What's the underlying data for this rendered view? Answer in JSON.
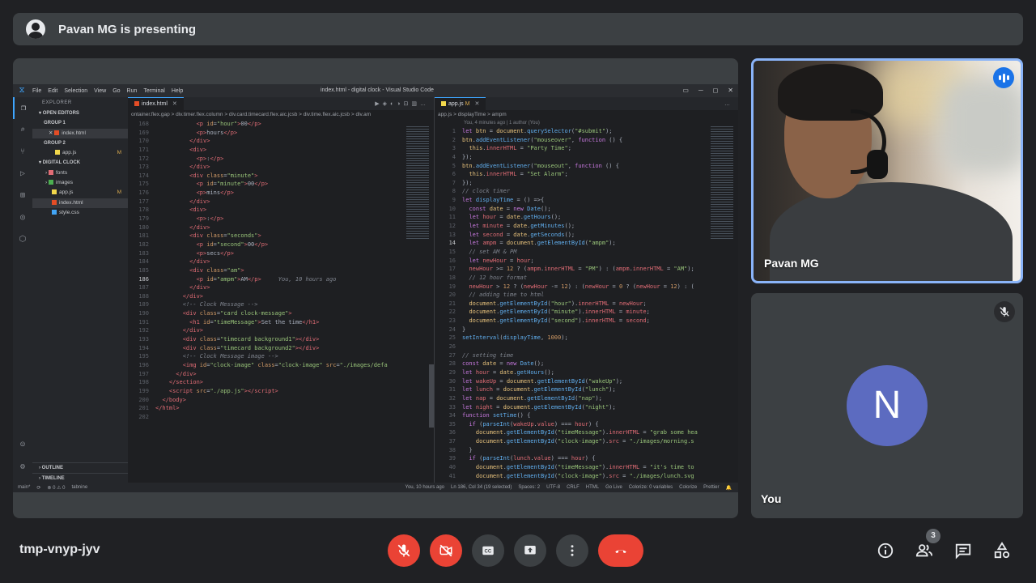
{
  "banner": {
    "text": "Pavan MG is presenting"
  },
  "vscode": {
    "window_title": "index.html - digital clock - Visual Studio Code",
    "menu": [
      "File",
      "Edit",
      "Selection",
      "View",
      "Go",
      "Run",
      "Terminal",
      "Help"
    ],
    "explorer": {
      "header": "EXPLORER",
      "open_editors": "OPEN EDITORS",
      "group1": "GROUP 1",
      "group1_file": "index.html",
      "group2": "GROUP 2",
      "group2_file": "app.js",
      "group2_mark": "M",
      "project": "DIGITAL CLOCK",
      "items": [
        {
          "label": "fonts",
          "mark": ""
        },
        {
          "label": "images",
          "mark": ""
        },
        {
          "label": "app.js",
          "mark": "M"
        },
        {
          "label": "index.html",
          "mark": ""
        },
        {
          "label": "style.css",
          "mark": ""
        }
      ],
      "outline": "OUTLINE",
      "timeline": "TIMELINE"
    },
    "left_tab": "index.html",
    "left_breadcrumb": "ontainer.flex.gap > div.timer.flex.column > div.card.timecard.flex.aic.jcsb > div.time.flex.aic.jcsb > div.am",
    "right_tab": "app.js",
    "right_tab_mark": "M",
    "right_breadcrumb": "app.js > displayTime > ampm",
    "blame": "You, 4 minutes ago | 1 author (You)",
    "inline_blame": "You, 10 hours ago",
    "status": {
      "branch": "main*",
      "problems": "⊗ 0 ⚠ 0",
      "tabnine": "tabnine",
      "blame": "You, 10 hours ago",
      "position": "Ln 186, Col 34 (19 selected)",
      "spaces": "Spaces: 2",
      "encoding": "UTF-8",
      "eol": "CRLF",
      "lang": "HTML",
      "golive": "Go Live",
      "colorize": "Colorize: 0 variables",
      "colorize2": "Colorize",
      "prettier": "Prettier"
    }
  },
  "tiles": {
    "presenter_name": "Pavan MG",
    "self_name": "You",
    "self_initial": "N"
  },
  "meeting": {
    "code": "tmp-vnyp-jyv",
    "participants_count": "3"
  },
  "colors": {
    "end_call": "#ea4335",
    "avatar": "#5c6bc0",
    "active_border": "#8ab4f8"
  }
}
